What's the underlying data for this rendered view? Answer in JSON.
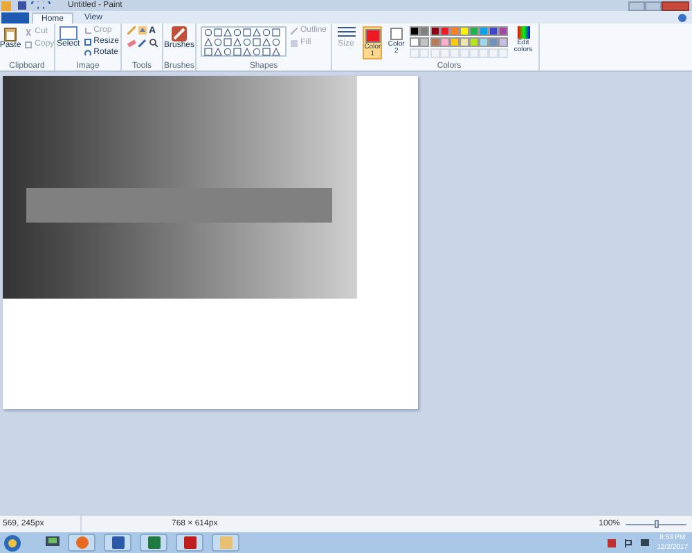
{
  "window": {
    "title": "Untitled - Paint"
  },
  "tabs": [
    {
      "label": "Home",
      "selected": true
    },
    {
      "label": "View",
      "selected": false
    }
  ],
  "clipboard": {
    "paste": "Paste",
    "cut": "Cut",
    "copy": "Copy",
    "label": "Clipboard"
  },
  "image": {
    "select": "Select",
    "crop": "Crop",
    "resize": "Resize",
    "rotate": "Rotate",
    "label": "Image"
  },
  "tools": {
    "label": "Tools",
    "text_tool": "A"
  },
  "brushes": {
    "button": "Brushes",
    "label": "Brushes"
  },
  "shapes": {
    "outline": "Outline",
    "fill": "Fill",
    "label": "Shapes"
  },
  "size": {
    "label": "Size"
  },
  "colors": {
    "color1": "Color 1",
    "color2": "Color 2",
    "color1_selected": true,
    "label": "Colors",
    "edit": "Edit colors",
    "swatches": [
      {
        "color": "#000000"
      },
      {
        "color": "#7f7f7f"
      },
      {
        "color": "#880015"
      },
      {
        "color": "#ed1c24"
      },
      {
        "color": "#ff7f27"
      },
      {
        "color": "#fff200"
      },
      {
        "color": "#22b14c"
      },
      {
        "color": "#00a2e8"
      },
      {
        "color": "#3f48cc"
      },
      {
        "color": "#a349a4"
      },
      {
        "color": "#ffffff"
      },
      {
        "color": "#c3c3c3"
      },
      {
        "color": "#b97a57"
      },
      {
        "color": "#ffaec9"
      },
      {
        "color": "#ffc90e"
      },
      {
        "color": "#efe4b0"
      },
      {
        "color": "#b5e61d"
      },
      {
        "color": "#99d9ea"
      },
      {
        "color": "#7092be"
      },
      {
        "color": "#c8bfe7"
      }
    ]
  },
  "status_bar": {
    "cursor": "569, 245px",
    "dimensions": "768 × 614px",
    "zoom": "100%",
    "zoom_slider": {
      "level": 0.5
    }
  },
  "taskbar": {
    "time": "8:53 PM",
    "date": "12/2/2017"
  }
}
